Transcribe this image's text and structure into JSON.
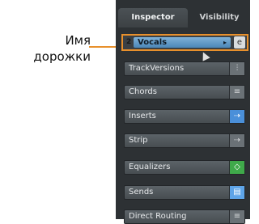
{
  "annotation": {
    "line1": "Имя",
    "line2": "дорожки"
  },
  "tabs": [
    {
      "label": "Inspector",
      "active": true
    },
    {
      "label": "Visibility",
      "active": false
    }
  ],
  "track": {
    "number": "2",
    "name": "Vocals",
    "arrow": "▸",
    "edit_glyph": "e"
  },
  "sections": [
    {
      "label": "TrackVersions",
      "icon": "versions-icon",
      "glyph": "⫶",
      "style": "neutral"
    },
    {
      "label": "Chords",
      "icon": "chords-icon",
      "glyph": "≡",
      "style": "neutral"
    },
    {
      "label": "Inserts",
      "icon": "inserts-icon",
      "glyph": "⇢",
      "style": "blue"
    },
    {
      "label": "Strip",
      "icon": "strip-icon",
      "glyph": "⇢",
      "style": "neutral"
    },
    {
      "label": "Equalizers",
      "icon": "eq-icon",
      "glyph": "◇",
      "style": "green"
    },
    {
      "label": "Sends",
      "icon": "sends-icon",
      "glyph": "▤",
      "style": "lightblue"
    },
    {
      "label": "Direct Routing",
      "icon": "routing-icon",
      "glyph": "≡",
      "style": "neutral"
    }
  ],
  "colors": {
    "highlight": "#e8902c",
    "track_blue": "#5b95c6"
  }
}
